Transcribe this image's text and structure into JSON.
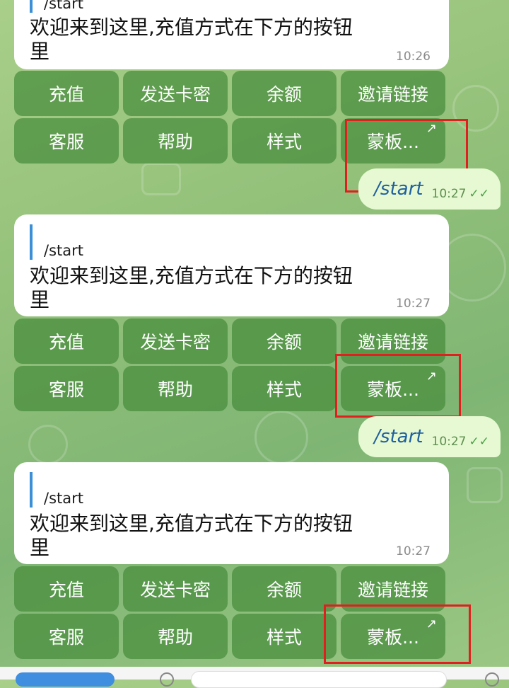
{
  "colors": {
    "incoming_bubble": "#ffffff",
    "outgoing_bubble": "#e6f9d2",
    "reply_bar": "#3a8fd6",
    "keyboard_button": "#468c3c",
    "highlight": "#e0201f"
  },
  "messages": [
    {
      "reply_to": "/start",
      "text_line1": "欢迎来到这里,充值方式在下方的按钮",
      "text_line2": "里",
      "time": "10:26",
      "keyboard": {
        "row1": [
          "充值",
          "发送卡密",
          "余额",
          "邀请链接"
        ],
        "row2": [
          "客服",
          "帮助",
          "样式",
          "蒙板..."
        ]
      },
      "outgoing": {
        "text": "/start",
        "time": "10:27",
        "status_icon": "double-check-icon"
      }
    },
    {
      "reply_to": "/start",
      "text_line1": "欢迎来到这里,充值方式在下方的按钮",
      "text_line2": "里",
      "time": "10:27",
      "keyboard": {
        "row1": [
          "充值",
          "发送卡密",
          "余额",
          "邀请链接"
        ],
        "row2": [
          "客服",
          "帮助",
          "样式",
          "蒙板..."
        ]
      },
      "outgoing": {
        "text": "/start",
        "time": "10:27",
        "status_icon": "double-check-icon"
      }
    },
    {
      "reply_to": "/start",
      "text_line1": "欢迎来到这里,充值方式在下方的按钮",
      "text_line2": "里",
      "time": "10:27",
      "keyboard": {
        "row1": [
          "充值",
          "发送卡密",
          "余额",
          "邀请链接"
        ],
        "row2": [
          "客服",
          "帮助",
          "样式",
          "蒙板..."
        ]
      }
    }
  ],
  "icons": {
    "web_app_arrow": "↗",
    "double_check": "✓✓"
  }
}
